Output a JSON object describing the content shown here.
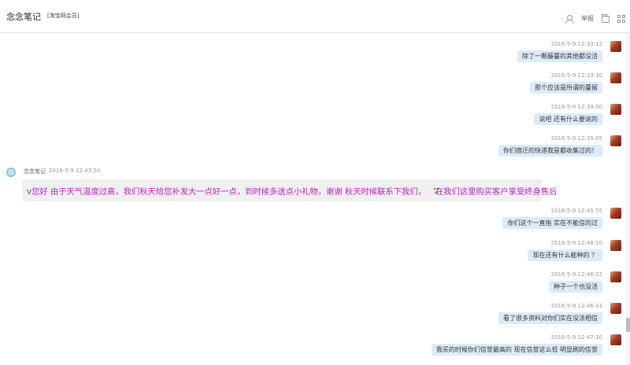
{
  "header": {
    "title": "念念笔记",
    "subtitle": "[淘宝网会员]",
    "report_label": "举报"
  },
  "colors": {
    "outgoing_bubble": "#dcebf8",
    "incoming_bubble": "#f0f0f0",
    "incoming_text": "#c11fc4"
  },
  "messages": [
    {
      "time": "2016-5-9 12:33:12",
      "text": "除了一颗藤蔓的其他都没活"
    },
    {
      "time": "2016-5-9 12:33:30",
      "text": "那个应该是所谓的蔓留"
    },
    {
      "time": "2016-5-9 12:34:00",
      "text": "说吧 还有什么要说的"
    },
    {
      "time": "2016-5-9 12:35:05",
      "text": "你们宿迁的快递我是都收集过的！"
    },
    {
      "sender": "念念笔记",
      "time": "2016-5-9 12:43:50",
      "text_before": "v您好 由于天气温度过高，我们秋天给您补发大一点好一点，到时候多送点小礼物，谢谢 秋天时候联系下我们，",
      "text_after": "在我们这里购买客户享受终身售后"
    },
    {
      "time": "2016-5-9 12:45:55",
      "text": "你们这个一直拖 实在不能信的过"
    },
    {
      "time": "2016-5-9 12:46:10",
      "text": "现在还有什么能种的 ？"
    },
    {
      "time": "2016-5-9 12:46:22",
      "text": "种子一个也没活"
    },
    {
      "time": "2016-5-9 12:46:43",
      "text": "看了很多资料对你们实在没法相信"
    },
    {
      "time": "2016-5-9 12:47:10",
      "text": "我买的时候你们信誉最高的 现在信誉这么低 明显刷的信誉"
    }
  ]
}
